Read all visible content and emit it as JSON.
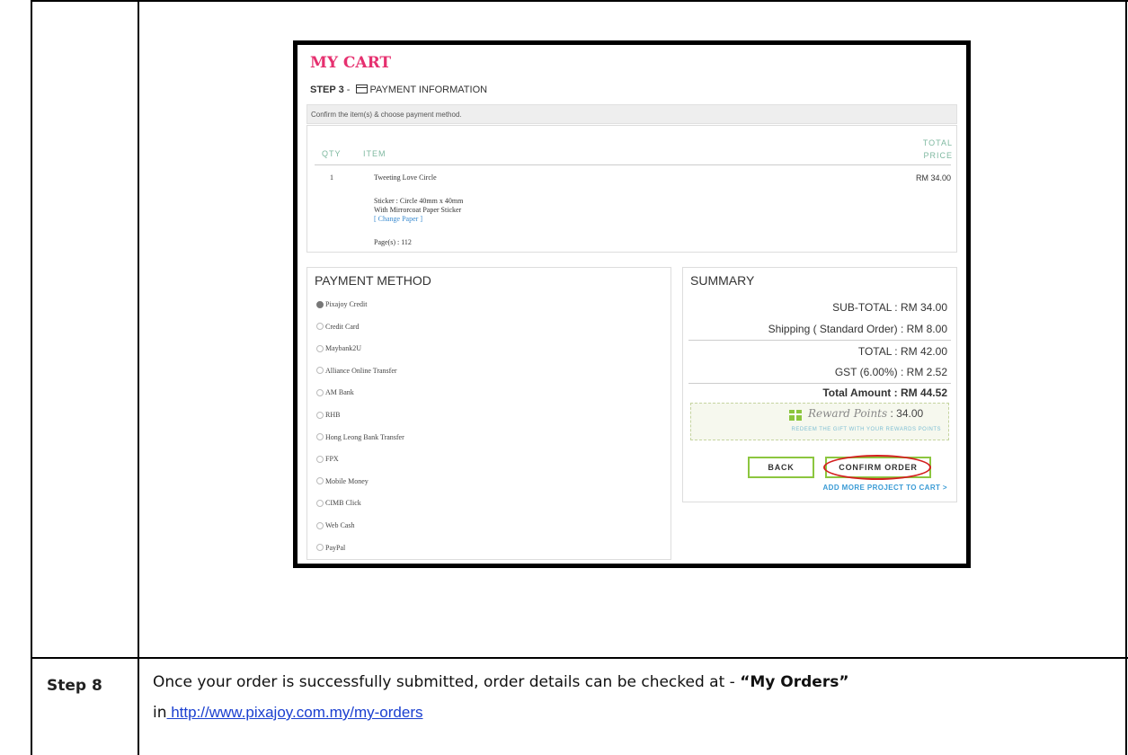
{
  "cart": {
    "title": "MY CART",
    "step_label": "STEP 3",
    "step_sep": " - ",
    "step_title": "PAYMENT INFORMATION",
    "confirm_text": "Confirm the item(s) & choose payment method.",
    "columns": {
      "qty": "QTY",
      "item": "ITEM",
      "total1": "TOTAL",
      "total2": "PRICE"
    },
    "item": {
      "qty": "1",
      "name": "Tweeting Love Circle",
      "price": "RM 34.00",
      "detail1": "Sticker : Circle 40mm x 40mm",
      "detail2": "With Mirrorcoat Paper Sticker",
      "change_link": "[ Change Paper ]",
      "pages": "Page(s) : 112"
    }
  },
  "payment": {
    "title": "PAYMENT METHOD",
    "options": [
      {
        "label": "Pixajoy Credit",
        "selected": true
      },
      {
        "label": "Credit Card",
        "selected": false
      },
      {
        "label": "Maybank2U",
        "selected": false
      },
      {
        "label": "Alliance Online Transfer",
        "selected": false
      },
      {
        "label": "AM Bank",
        "selected": false
      },
      {
        "label": "RHB",
        "selected": false
      },
      {
        "label": "Hong Leong Bank Transfer",
        "selected": false
      },
      {
        "label": "FPX",
        "selected": false
      },
      {
        "label": "Mobile Money",
        "selected": false
      },
      {
        "label": "CIMB Click",
        "selected": false
      },
      {
        "label": "Web Cash",
        "selected": false
      },
      {
        "label": "PayPal",
        "selected": false
      }
    ]
  },
  "summary": {
    "title": "SUMMARY",
    "subtotal": "SUB-TOTAL : RM 34.00",
    "shipping": "Shipping ( Standard Order) : RM 8.00",
    "total": "TOTAL : RM 42.00",
    "gst": "GST (6.00%) : RM 2.52",
    "total_amount": "Total Amount : RM 44.52",
    "reward_label": "Reward Points",
    "reward_value": " : 34.00",
    "reward_sub": "REDEEM THE GIFT WITH YOUR REWARDS POINTS",
    "back": "BACK",
    "confirm": "CONFIRM ORDER",
    "add_more": "ADD MORE PROJECT TO CART >"
  },
  "step": {
    "label": "Step 8",
    "text_before": "Once your order is successfully submitted, order details can be checked at - ",
    "bold": "“My Orders”",
    "text_in": "in",
    "link": " http://www.pixajoy.com.my/my-orders"
  }
}
